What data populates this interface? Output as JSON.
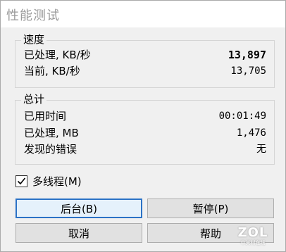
{
  "window": {
    "title": "性能测试"
  },
  "speed": {
    "legend": "速度",
    "processed_label": "已处理, KB/秒",
    "processed_value": "13,897",
    "current_label": "当前, KB/秒",
    "current_value": "13,705"
  },
  "total": {
    "legend": "总计",
    "elapsed_label": "已用时间",
    "elapsed_value": "00:01:49",
    "processed_label": "已处理, MB",
    "processed_value": "1,476",
    "errors_label": "发现的错误",
    "errors_value": "无"
  },
  "multithread": {
    "label": "多线程(M)",
    "checked": true
  },
  "buttons": {
    "background": "后台(B)",
    "pause": "暂停(P)",
    "cancel": "取消",
    "help": "帮助"
  },
  "watermark": {
    "logo": "ZOL",
    "sub": "中关村在线"
  }
}
